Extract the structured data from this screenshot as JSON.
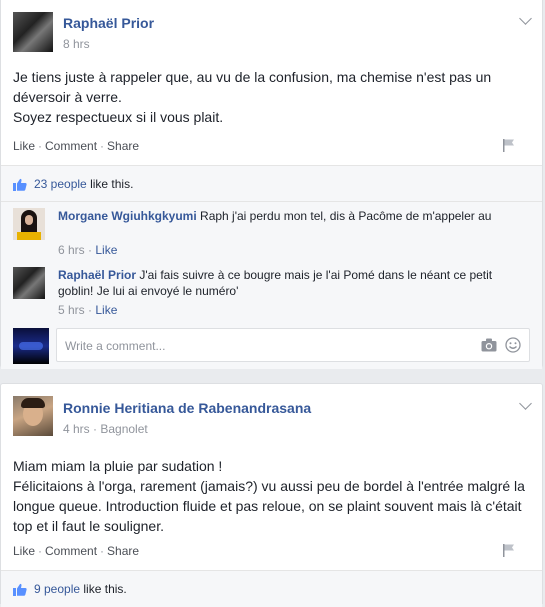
{
  "posts": [
    {
      "author": "Raphaël Prior",
      "time": "8 hrs",
      "lines": [
        "Je tiens juste à rappeler que, au vu de la confusion, ma chemise n'est pas un déversoir à verre.",
        "Soyez respectueux si il vous plait."
      ],
      "actions": {
        "like": "Like",
        "comment": "Comment",
        "share": "Share"
      },
      "likes": {
        "people": "23 people",
        "suffix": "like this."
      },
      "comments": [
        {
          "author": "Morgane Wgiuhkgkyumi",
          "text": "Raph j'ai perdu mon tel, dis à Pacôme de m'appeler au",
          "time": "6 hrs",
          "like": "Like"
        },
        {
          "author": "Raphaël Prior",
          "text": "J'ai fais suivre à ce bougre mais je l'ai Pomé dans le néant ce petit goblin! Je lui ai envoyé le numéro'",
          "time": "5 hrs",
          "like": "Like"
        }
      ],
      "write_placeholder": "Write a comment..."
    },
    {
      "author": "Ronnie Heritiana de Rabenandrasana",
      "time": "4 hrs",
      "location": "Bagnolet",
      "lines": [
        "Miam miam la pluie par sudation !",
        "Félicitaions à l'orga, rarement (jamais?) vu aussi peu de bordel à l'entrée malgré la longue queue. Introduction fluide et pas reloue, on se plaint souvent mais là c'était top et il faut le souligner."
      ],
      "actions": {
        "like": "Like",
        "comment": "Comment",
        "share": "Share"
      },
      "likes": {
        "people": "9 people",
        "suffix": "like this."
      }
    }
  ],
  "icons": {
    "options": "chevron-down-icon",
    "flag": "flag-icon",
    "thumb": "thumbs-up-icon",
    "camera": "camera-icon",
    "emoji": "smiley-icon"
  },
  "colors": {
    "link": "#365899",
    "meta": "#90949c",
    "likebar": "#f6f7f9"
  }
}
